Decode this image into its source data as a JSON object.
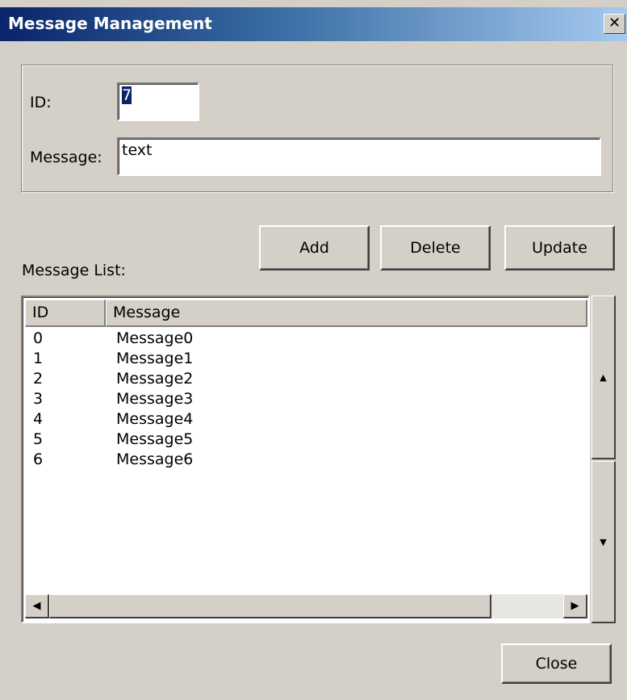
{
  "window": {
    "title": "Message Management",
    "close_glyph": "✕"
  },
  "form": {
    "id_label": "ID:",
    "id_value": "7",
    "message_label": "Message:",
    "message_value": "text"
  },
  "buttons": {
    "add": "Add",
    "delete": "Delete",
    "update": "Update",
    "close": "Close"
  },
  "list": {
    "label": "Message List:",
    "columns": [
      "ID",
      "Message"
    ],
    "rows": [
      {
        "id": "0",
        "message": "Message0"
      },
      {
        "id": "1",
        "message": "Message1"
      },
      {
        "id": "2",
        "message": "Message2"
      },
      {
        "id": "3",
        "message": "Message3"
      },
      {
        "id": "4",
        "message": "Message4"
      },
      {
        "id": "5",
        "message": "Message5"
      },
      {
        "id": "6",
        "message": "Message6"
      }
    ]
  },
  "scroll": {
    "left_glyph": "◀",
    "right_glyph": "▶",
    "up_glyph": "▲",
    "down_glyph": "▼"
  },
  "colors": {
    "titlebar_start": "#0a246a",
    "titlebar_end": "#a6caf0",
    "face": "#d4d0c8",
    "selection": "#0a246a"
  }
}
